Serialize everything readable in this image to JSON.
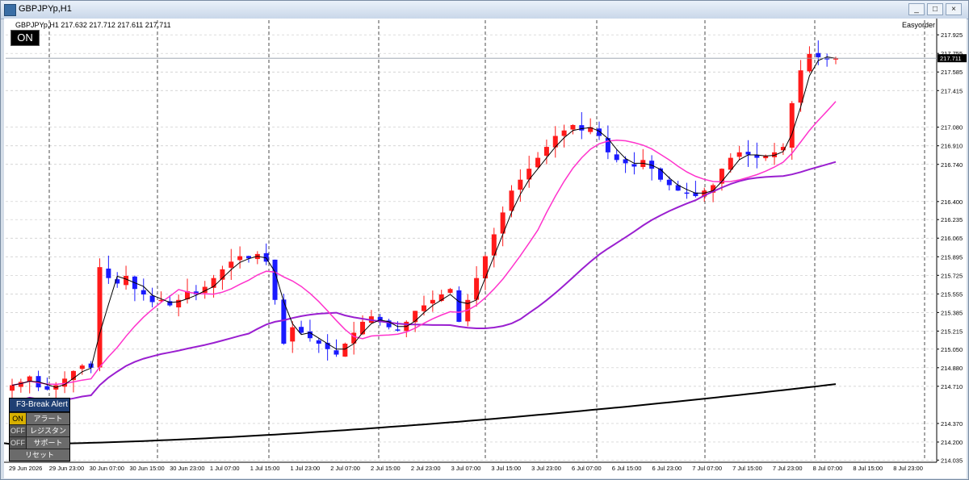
{
  "window": {
    "title": "GBPJPYp,H1",
    "controls": {
      "minimize": "_",
      "maximize": "□",
      "close": "×"
    }
  },
  "chart": {
    "symbol_info": "GBPJPYp,H1  217.632 217.712 217.611 217.711",
    "ea_name": "Easyorder",
    "on_badge": "ON",
    "current_price_label": "217.711"
  },
  "alert_panel": {
    "title": "F3-Break Alert",
    "rows": [
      {
        "state": "ON",
        "label": "アラート"
      },
      {
        "state": "OFF",
        "label": "レジスタンス"
      },
      {
        "state": "OFF",
        "label": "サポート"
      }
    ],
    "reset_label": "リセット"
  },
  "colors": {
    "bull_candle": "#ff1a1a",
    "bear_candle": "#1a1aff",
    "ma_fast": "#000000",
    "ma_mid": "#ff33cc",
    "ma_slow": "#9a1fd0",
    "ma_long": "#000000",
    "bb_cyan": "#39c0e8"
  },
  "chart_data": {
    "type": "candlestick",
    "title": "GBPJPYp,H1",
    "y_ticks": [
      "217.925",
      "217.755",
      "217.585",
      "217.415",
      "217.080",
      "216.910",
      "216.740",
      "216.400",
      "216.235",
      "216.065",
      "215.895",
      "215.725",
      "215.555",
      "215.385",
      "215.215",
      "215.050",
      "214.880",
      "214.710",
      "214.370",
      "214.200",
      "214.035"
    ],
    "x_ticks": [
      "29 Jun 2026",
      "29 Jun 23:00",
      "30 Jun 07:00",
      "30 Jun 15:00",
      "30 Jun 23:00",
      "1 Jul 07:00",
      "1 Jul 15:00",
      "1 Jul 23:00",
      "2 Jul 07:00",
      "2 Jul 15:00",
      "2 Jul 23:00",
      "3 Jul 07:00",
      "3 Jul 15:00",
      "3 Jul 23:00",
      "6 Jul 07:00",
      "6 Jul 15:00",
      "6 Jul 23:00",
      "7 Jul 07:00",
      "7 Jul 15:00",
      "7 Jul 23:00",
      "8 Jul 07:00",
      "8 Jul 15:00",
      "8 Jul 23:00"
    ],
    "ylim": [
      214.03,
      218.0
    ],
    "current_price": 217.711,
    "close_path": [
      214.72,
      214.75,
      214.8,
      214.7,
      214.68,
      214.72,
      214.78,
      214.85,
      214.9,
      214.88,
      215.8,
      215.7,
      215.65,
      215.72,
      215.6,
      215.55,
      215.48,
      215.5,
      215.45,
      215.5,
      215.58,
      215.55,
      215.62,
      215.7,
      215.78,
      215.85,
      215.9,
      215.88,
      215.92,
      215.85,
      215.5,
      215.1,
      215.25,
      215.2,
      215.15,
      215.1,
      215.05,
      215.0,
      215.1,
      215.2,
      215.3,
      215.35,
      215.3,
      215.25,
      215.22,
      215.3,
      215.4,
      215.45,
      215.5,
      215.55,
      215.6,
      215.3,
      215.5,
      215.7,
      215.9,
      216.1,
      216.3,
      216.5,
      216.6,
      216.7,
      216.8,
      216.9,
      217.0,
      217.05,
      217.1,
      217.05,
      217.08,
      217.0,
      216.85,
      216.78,
      216.75,
      216.72,
      216.78,
      216.7,
      216.6,
      216.55,
      216.5,
      216.48,
      216.45,
      216.5,
      216.55,
      216.7,
      216.8,
      216.85,
      216.83,
      216.8,
      216.82,
      216.85,
      216.9,
      217.3,
      217.6,
      217.75,
      217.72,
      217.7,
      217.71
    ],
    "series": [
      {
        "name": "MA fast",
        "values": []
      },
      {
        "name": "MA mid",
        "values": []
      },
      {
        "name": "MA slow",
        "values": []
      },
      {
        "name": "MA long",
        "values": []
      }
    ],
    "grid": true
  }
}
